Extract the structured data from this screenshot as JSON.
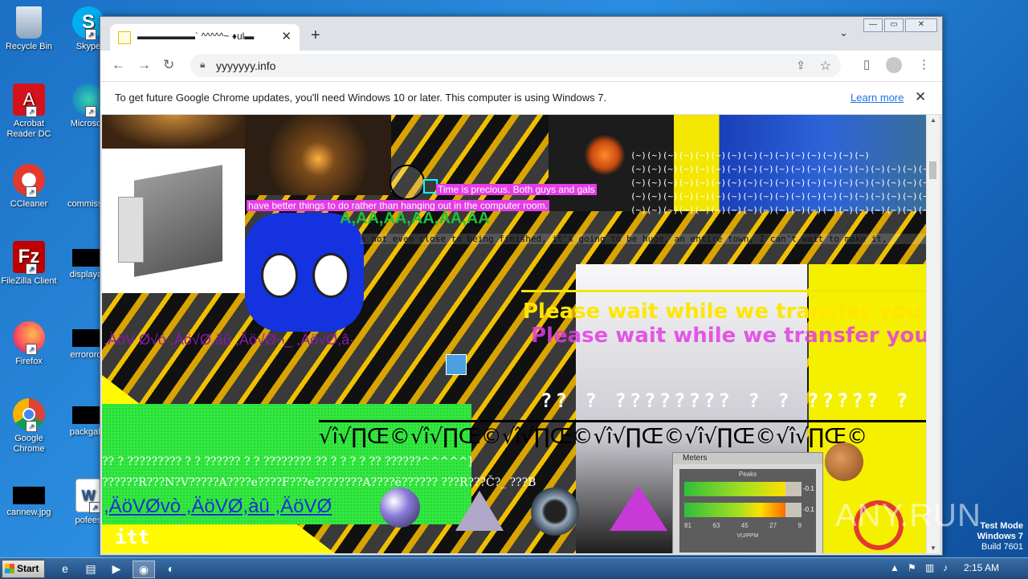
{
  "desktop": {
    "icons": [
      {
        "label": "Recycle Bin",
        "icon": "recycle-bin-icon"
      },
      {
        "label": "Skype",
        "icon": "skype-icon"
      },
      {
        "label": "Acrobat Reader DC",
        "icon": "acrobat-icon"
      },
      {
        "label": "Microsoft",
        "icon": "edge-icon"
      },
      {
        "label": "CCleaner",
        "icon": "ccleaner-icon"
      },
      {
        "label": "commissio",
        "icon": "file-icon"
      },
      {
        "label": "FileZilla Client",
        "icon": "filezilla-icon"
      },
      {
        "label": "displayau",
        "icon": "file-icon"
      },
      {
        "label": "Firefox",
        "icon": "firefox-icon"
      },
      {
        "label": "errororde",
        "icon": "file-icon"
      },
      {
        "label": "Google Chrome",
        "icon": "chrome-icon"
      },
      {
        "label": "packgalle",
        "icon": "file-icon"
      },
      {
        "label": "cannew.jpg",
        "icon": "file-icon"
      },
      {
        "label": "pofees",
        "icon": "word-icon"
      }
    ]
  },
  "browser": {
    "tab_title": "▬▬▬▬▬▬` ^^^^^~ ♦ul▬",
    "close_tab": "✕",
    "new_tab": "+",
    "tab_dropdown": "⌄",
    "url": "yyyyyyy.info",
    "window_controls": {
      "minimize": "—",
      "restore": "▭",
      "close": "✕"
    },
    "infobar": {
      "message": "To get future Google Chrome updates, you'll need Windows 10 or later. This computer is using Windows 7.",
      "link": "Learn more",
      "close": "✕"
    },
    "nav": {
      "back": "←",
      "forward": "→",
      "reload": "↻"
    }
  },
  "page": {
    "time_text_1": "Time is precious. Both guys and gals",
    "time_text_2": "have better things to do rather than hanging out in the computer room.",
    "green_text": "A,ÄA,ÄA,ÄA,ÄA,ÄA",
    "mono_text": "s not even close to being finished, it's going to be huge, an entire town, I can't wait to make it,",
    "parens_rows": [
      "(~)(~)(~)(~)(~)(~)(~)(~)(~)(~)(~)(~)(~)(~)(~)",
      "(~)(~)(~)(~)(~)(~)(~)(~)(~)(~)(~)(~)(~)(~)(~)(~)(~)(~)(~)(~)(~)(~)(~)(~)(~)(~)(~)(~)",
      "(~)(~)(~)(~)(~)(~)(~)(~)(~)(~)(~)(~)(~)(~)(~)(~)(~)(~)(~)(~)(~)(~)(~)(~)(~)(~)(~)(~)",
      "(~)(~)(~)(~)(~)(~)(~)(~)(~)(~)(~)(~)(~)(~)(~)(~)(~)(~)(~)(~)(~)(~)(~)(~)(~)(~)(~)(~)",
      "(~)(~)(~)(~)(~)(~)(~)(~)(~)(~)(~)(~)(~)(~)(~)(~)(~)(~)(~)(~)(~)(~)(~)(~)(~)(~)(~)(~)"
    ],
    "please_wait": "Please wait while we transfer you...",
    "purple_garble": ",ÄöV Ø√ó ,Äö√Ø,âû ,Äö√Ø¬_ ,Äö√Ø,â·",
    "question_row": "?? ? ???????? ? ? ????? ?",
    "big_garble": "√î√∏Œ©√î√∏Œ©√î√∏Œ©√î√∏Œ©√î√∏Œ©√î√∏Œ©",
    "white_garble_1": "?? ? ????????? ? ? ?????? ? ? ???????? ?? ? ? ? ? ?? ??????^^^^^]",
    "white_garble_2": "??????R???N?V?????A????e????F???e????????A????ë?????? ???R???Č?_ ???B",
    "link_garble": ",ÄöVØvò ,ÄöVØ,àû ,ÄöVØ",
    "itt": "itt",
    "meters_title": "Meters",
    "peaks_label": "Peaks",
    "peak_value_1": "-0.1",
    "peak_value_2": "-0.1",
    "peak_fill_1": 0.86,
    "peak_fill_2": 0.86,
    "meter_ticks": [
      "81",
      "63",
      "45",
      "27",
      "9"
    ],
    "meter_unit": "VU/PPM"
  },
  "taskbar": {
    "start_label": "Start",
    "clock": "2:15 AM",
    "watermark": "ANY.RUN",
    "testmode": [
      "Test Mode",
      "Windows 7",
      "Build 7601"
    ]
  }
}
